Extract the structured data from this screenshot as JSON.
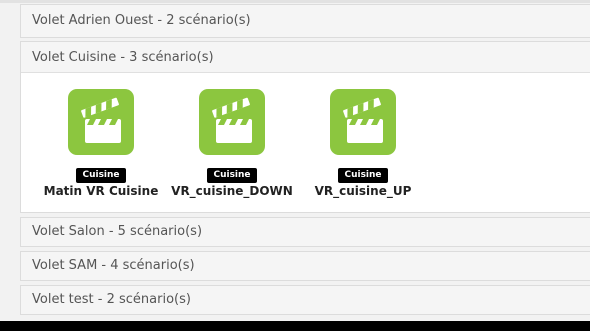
{
  "colors": {
    "scene_icon_bg": "#8cc63f",
    "tag_bg": "#000000",
    "bottom_bar": "#000000"
  },
  "panels": [
    {
      "title": "Volet Adrien Ouest - 2 scénario(s)"
    },
    {
      "title": "Volet Cuisine - 3 scénario(s)",
      "scenes": [
        {
          "icon": "clapperboard-icon",
          "tag": "Cuisine",
          "name": "Matin VR Cuisine"
        },
        {
          "icon": "clapperboard-icon",
          "tag": "Cuisine",
          "name": "VR_cuisine_DOWN"
        },
        {
          "icon": "clapperboard-icon",
          "tag": "Cuisine",
          "name": "VR_cuisine_UP"
        }
      ]
    },
    {
      "title": "Volet Salon - 5 scénario(s)"
    },
    {
      "title": "Volet SAM - 4 scénario(s)"
    },
    {
      "title": "Volet test - 2 scénario(s)"
    }
  ]
}
